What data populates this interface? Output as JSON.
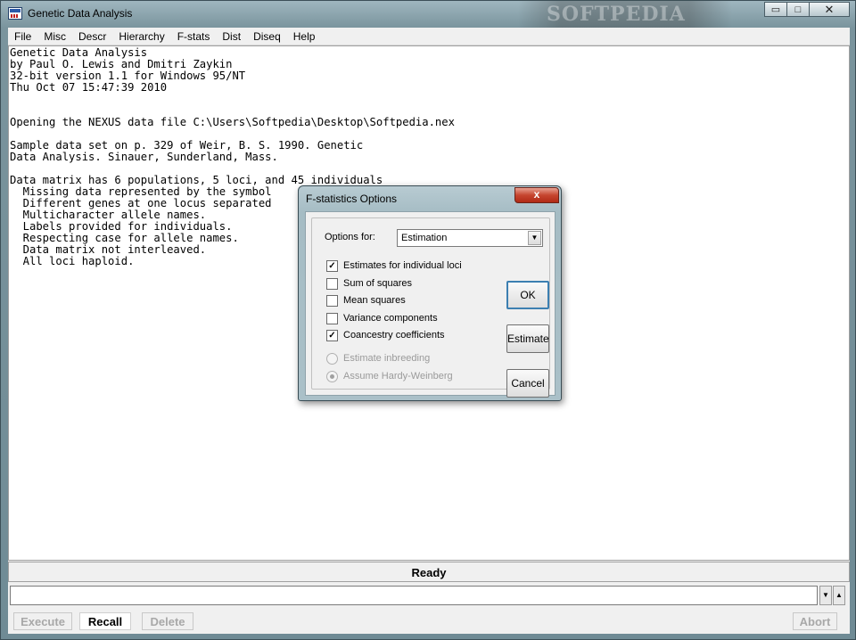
{
  "window": {
    "title": "Genetic Data Analysis",
    "watermark": "SOFTPEDIA"
  },
  "caption": {
    "minimize": "▭",
    "maximize": "□",
    "close": "✕"
  },
  "menu": [
    "File",
    "Misc",
    "Descr",
    "Hierarchy",
    "F-stats",
    "Dist",
    "Diseq",
    "Help"
  ],
  "output_text": "Genetic Data Analysis\nby Paul O. Lewis and Dmitri Zaykin\n32-bit version 1.1 for Windows 95/NT\nThu Oct 07 15:47:39 2010\n\n\nOpening the NEXUS data file C:\\Users\\Softpedia\\Desktop\\Softpedia.nex\n\nSample data set on p. 329 of Weir, B. S. 1990. Genetic\nData Analysis. Sinauer, Sunderland, Mass.\n\nData matrix has 6 populations, 5 loci, and 45 individuals\n  Missing data represented by the symbol\n  Different genes at one locus separated\n  Multicharacter allele names.\n  Labels provided for individuals.\n  Respecting case for allele names.\n  Data matrix not interleaved.\n  All loci haploid.",
  "status": "Ready",
  "command_input": {
    "value": ""
  },
  "buttons": {
    "execute": "Execute",
    "recall": "Recall",
    "delete": "Delete",
    "abort": "Abort"
  },
  "dialog": {
    "title": "F-statistics Options",
    "close": "x",
    "options_for_label": "Options for:",
    "options_for_value": "Estimation",
    "checkboxes": [
      {
        "label": "Estimates for individual loci",
        "checked": true
      },
      {
        "label": "Sum of squares",
        "checked": false
      },
      {
        "label": "Mean squares",
        "checked": false
      },
      {
        "label": "Variance components",
        "checked": false
      },
      {
        "label": "Coancestry coefficients",
        "checked": true
      }
    ],
    "radios": [
      {
        "label": "Estimate inbreeding",
        "selected": false
      },
      {
        "label": "Assume Hardy-Weinberg",
        "selected": true
      }
    ],
    "ok": "OK",
    "estimate": "Estimate",
    "cancel": "Cancel"
  }
}
